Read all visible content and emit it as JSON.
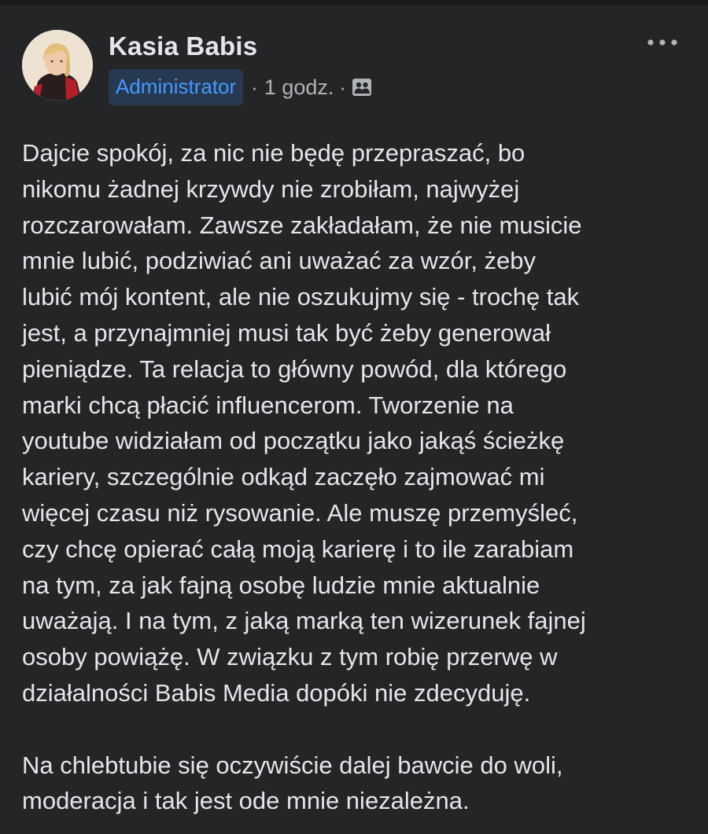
{
  "post": {
    "author": {
      "name": "Kasia Babis",
      "role": "Administrator"
    },
    "timestamp": "1 godz.",
    "separator": "·",
    "audience_icon": "group-members-icon",
    "menu_icon": "more-options-icon",
    "body": {
      "paragraph_1": [
        "Dajcie spokój, za nic nie będę przepraszać, bo",
        "nikomu żadnej krzywdy nie zrobiłam, najwyżej",
        "rozczarowałam. Zawsze zakładałam, że nie musicie",
        "mnie lubić, podziwiać ani uważać za wzór, żeby",
        "lubić mój kontent, ale nie oszukujmy się - trochę tak",
        "jest, a przynajmniej musi tak być żeby generował",
        "pieniądze. Ta relacja to główny powód, dla którego",
        "marki chcą płacić influencerom. Tworzenie na",
        "youtube widziałam od początku jako jakąś ścieżkę",
        "kariery, szczególnie odkąd zaczęło zajmować mi",
        "więcej czasu niż rysowanie. Ale muszę przemyśleć,",
        "czy chcę opierać całą moją karierę i to ile zarabiam",
        "na tym, za jak fajną osobę ludzie mnie aktualnie",
        "uważają. I na tym, z jaką marką ten wizerunek fajnej",
        "osoby powiążę. W związku z tym robię przerwę w",
        "działalności Babis Media dopóki nie zdecyduję."
      ],
      "paragraph_2": [
        "Na chlebtubie się oczywiście dalej bawcie do woli,",
        "moderacja i tak jest ode mnie niezależna."
      ]
    }
  },
  "colors": {
    "background": "#242526",
    "text_primary": "#e4e6eb",
    "text_secondary": "#b0b3b8",
    "badge_background": "#263951",
    "badge_text": "#4599ff"
  }
}
